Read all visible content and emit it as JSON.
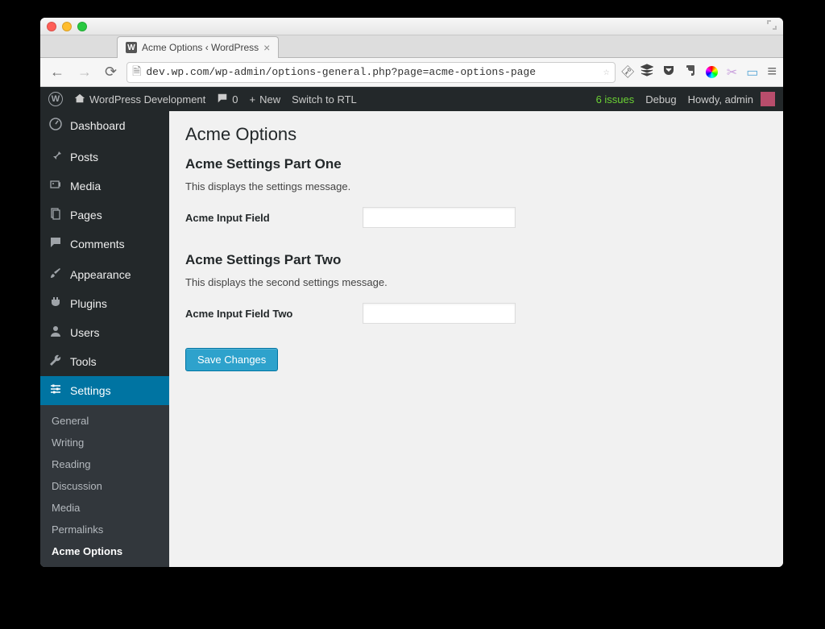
{
  "browser": {
    "tab_title": "Acme Options ‹ WordPress",
    "url": "dev.wp.com/wp-admin/options-general.php?page=acme-options-page"
  },
  "adminbar": {
    "site_name": "WordPress Development",
    "comment_count": "0",
    "new_label": "New",
    "rtl_label": "Switch to RTL",
    "issues": "6 issues",
    "debug": "Debug",
    "howdy": "Howdy, admin"
  },
  "sidebar": {
    "items": [
      {
        "label": "Dashboard",
        "iconClass": "dashboard"
      },
      {
        "label": "Posts",
        "iconClass": "posts"
      },
      {
        "label": "Media",
        "iconClass": "media"
      },
      {
        "label": "Pages",
        "iconClass": "pages"
      },
      {
        "label": "Comments",
        "iconClass": "comments"
      },
      {
        "label": "Appearance",
        "iconClass": "appearance"
      },
      {
        "label": "Plugins",
        "iconClass": "plugins"
      },
      {
        "label": "Users",
        "iconClass": "users"
      },
      {
        "label": "Tools",
        "iconClass": "tools"
      },
      {
        "label": "Settings",
        "iconClass": "settings"
      }
    ],
    "submenu": [
      "General",
      "Writing",
      "Reading",
      "Discussion",
      "Media",
      "Permalinks",
      "Acme Options"
    ]
  },
  "content": {
    "title": "Acme Options",
    "section1": {
      "heading": "Acme Settings Part One",
      "desc": "This displays the settings message.",
      "field_label": "Acme Input Field",
      "field_value": ""
    },
    "section2": {
      "heading": "Acme Settings Part Two",
      "desc": "This displays the second settings message.",
      "field_label": "Acme Input Field Two",
      "field_value": ""
    },
    "save_label": "Save Changes"
  }
}
